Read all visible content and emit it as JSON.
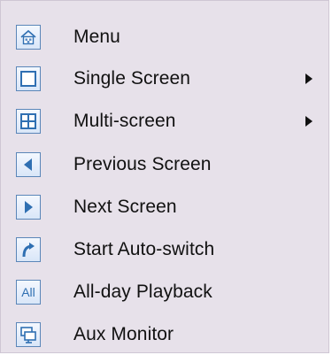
{
  "context_menu": {
    "items": [
      {
        "label": "Menu",
        "icon": "home-icon",
        "has_submenu": false
      },
      {
        "label": "Single Screen",
        "icon": "single-screen-icon",
        "has_submenu": true
      },
      {
        "label": "Multi-screen",
        "icon": "multi-screen-icon",
        "has_submenu": true
      },
      {
        "label": "Previous Screen",
        "icon": "previous-arrow-icon",
        "has_submenu": false
      },
      {
        "label": "Next Screen",
        "icon": "next-arrow-icon",
        "has_submenu": false
      },
      {
        "label": "Start Auto-switch",
        "icon": "auto-switch-icon",
        "has_submenu": false
      },
      {
        "label": "All-day Playback",
        "icon": "all-day-playback-icon",
        "icon_text": "All",
        "has_submenu": false
      },
      {
        "label": "Aux Monitor",
        "icon": "aux-monitor-icon",
        "has_submenu": false
      }
    ]
  },
  "colors": {
    "background": "#e7e1ea",
    "icon_border": "#5b86b8",
    "icon_fill": "#2f6fb2",
    "text": "#111111"
  }
}
